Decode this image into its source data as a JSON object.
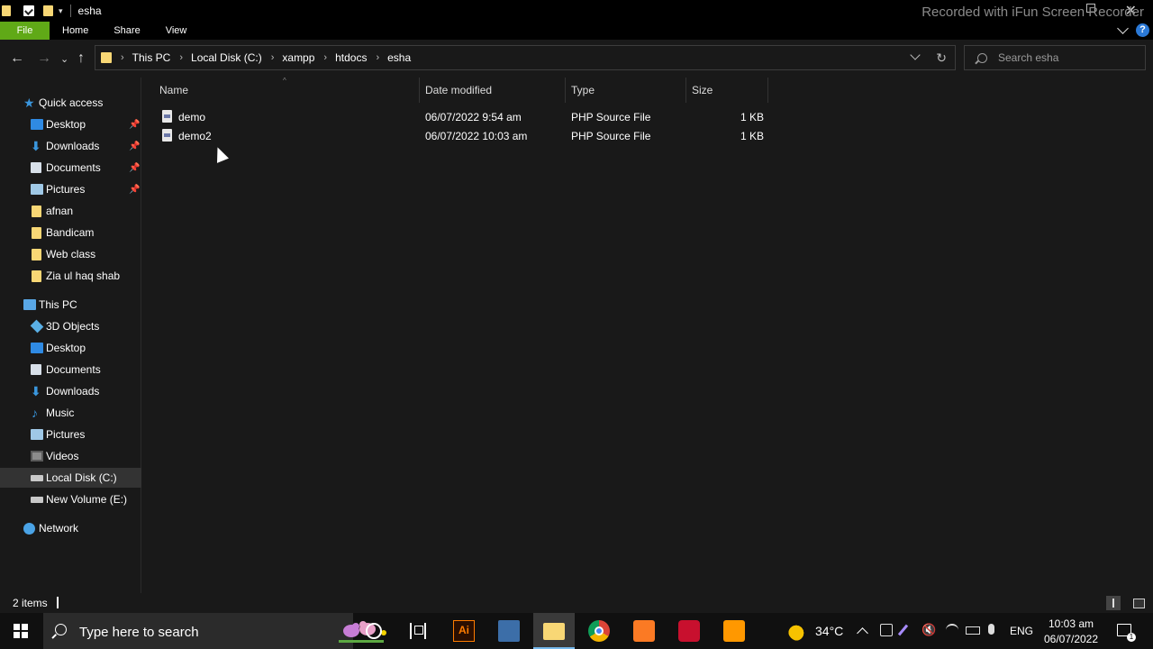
{
  "window": {
    "title": "esha",
    "watermark": "Recorded with iFun Screen Recorder"
  },
  "ribbon": {
    "tabs": [
      "File",
      "Home",
      "Share",
      "View"
    ]
  },
  "address": {
    "crumbs": [
      "This PC",
      "Local Disk (C:)",
      "xampp",
      "htdocs",
      "esha"
    ]
  },
  "search": {
    "placeholder": "Search esha"
  },
  "nav": {
    "quick_access": {
      "label": "Quick access",
      "items": [
        {
          "label": "Desktop",
          "icon": "desktop-icon",
          "pinned": true
        },
        {
          "label": "Downloads",
          "icon": "download-icon",
          "pinned": true
        },
        {
          "label": "Documents",
          "icon": "documents-icon",
          "pinned": true
        },
        {
          "label": "Pictures",
          "icon": "pictures-icon",
          "pinned": true
        },
        {
          "label": "afnan",
          "icon": "folder-icon",
          "pinned": false
        },
        {
          "label": "Bandicam",
          "icon": "folder-icon",
          "pinned": false
        },
        {
          "label": "Web class",
          "icon": "folder-icon",
          "pinned": false
        },
        {
          "label": "Zia ul haq shab",
          "icon": "folder-icon",
          "pinned": false
        }
      ]
    },
    "this_pc": {
      "label": "This PC",
      "items": [
        {
          "label": "3D Objects",
          "icon": "3d-objects-icon"
        },
        {
          "label": "Desktop",
          "icon": "desktop-icon"
        },
        {
          "label": "Documents",
          "icon": "documents-icon"
        },
        {
          "label": "Downloads",
          "icon": "download-icon"
        },
        {
          "label": "Music",
          "icon": "music-icon"
        },
        {
          "label": "Pictures",
          "icon": "pictures-icon"
        },
        {
          "label": "Videos",
          "icon": "videos-icon"
        },
        {
          "label": "Local Disk (C:)",
          "icon": "drive-icon",
          "selected": true
        },
        {
          "label": "New Volume (E:)",
          "icon": "drive-icon"
        }
      ]
    },
    "network": {
      "label": "Network"
    }
  },
  "columns": {
    "name": "Name",
    "date": "Date modified",
    "type": "Type",
    "size": "Size"
  },
  "files": [
    {
      "name": "demo",
      "date": "06/07/2022 9:54 am",
      "type": "PHP Source File",
      "size": "1 KB"
    },
    {
      "name": "demo2",
      "date": "06/07/2022 10:03 am",
      "type": "PHP Source File",
      "size": "1 KB"
    }
  ],
  "status": {
    "count": "2 items"
  },
  "taskbar": {
    "search_text": "Type here to search",
    "ai_label": "Ai",
    "temperature": "34°C",
    "language": "ENG",
    "time": "10:03 am",
    "date": "06/07/2022",
    "notification_count": "1"
  }
}
